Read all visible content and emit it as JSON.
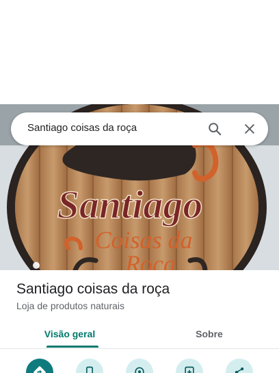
{
  "search": {
    "query": "Santiago coisas da roça",
    "search_icon": "search-icon",
    "close_icon": "close-icon"
  },
  "hero": {
    "sign_line1": "Santiago",
    "sign_line2": "Coisas da",
    "sign_line3": "Roça",
    "colors": {
      "wood": "#b5855a",
      "ink": "#7a2626",
      "orange": "#d2622b",
      "frame": "#2a2320"
    }
  },
  "place": {
    "title": "Santiago coisas da roça",
    "category": "Loja de produtos naturais"
  },
  "tabs": [
    {
      "label": "Visão geral",
      "selected": true
    },
    {
      "label": "Sobre",
      "selected": false
    }
  ],
  "actions": [
    {
      "icon": "directions-icon"
    },
    {
      "icon": "phone-icon"
    },
    {
      "icon": "save-location-icon"
    },
    {
      "icon": "add-contact-icon"
    },
    {
      "icon": "share-icon"
    }
  ],
  "colors": {
    "accent": "#00796b",
    "primary_action": "#0f7b7e",
    "secondary_action": "#d4eef0"
  }
}
